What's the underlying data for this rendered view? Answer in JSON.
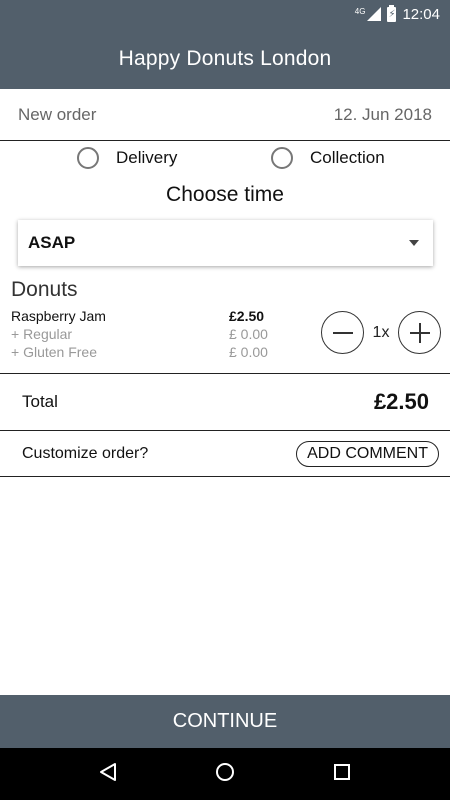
{
  "status_bar": {
    "network": "4G",
    "time": "12:04"
  },
  "app": {
    "title": "Happy Donuts London"
  },
  "order": {
    "label": "New order",
    "date": "12. Jun 2018"
  },
  "delivery": {
    "options": [
      "Delivery",
      "Collection"
    ]
  },
  "time_selection": {
    "title": "Choose time",
    "selected": "ASAP"
  },
  "section": {
    "title": "Donuts"
  },
  "item": {
    "name": "Raspberry Jam",
    "price": "£2.50",
    "options": [
      {
        "name": "+ Regular",
        "price": "£ 0.00"
      },
      {
        "name": "+ Gluten Free",
        "price": "£ 0.00"
      }
    ],
    "quantity": "1x"
  },
  "total": {
    "label": "Total",
    "value": "£2.50"
  },
  "customize": {
    "label": "Customize order?",
    "button": "ADD COMMENT"
  },
  "footer": {
    "continue_label": "CONTINUE"
  },
  "icons": [
    "signal-icon",
    "battery-icon",
    "radio-icon",
    "dropdown-arrow-icon",
    "minus-icon",
    "plus-icon",
    "back-icon",
    "home-icon",
    "recents-icon"
  ]
}
